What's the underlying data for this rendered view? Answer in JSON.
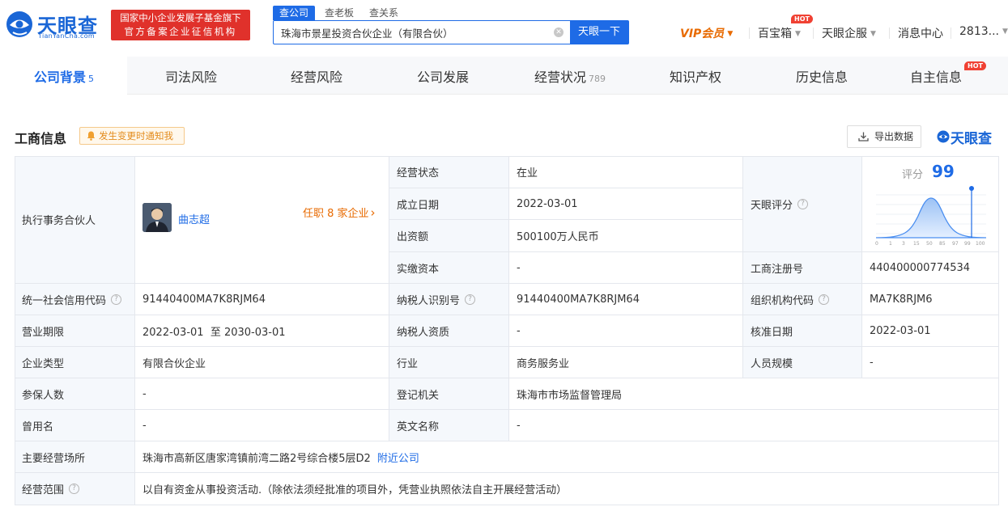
{
  "header": {
    "logo_cn": "天眼查",
    "logo_en": "TianYanCha.com",
    "banner_line1": "国家中小企业发展子基金旗下",
    "banner_line2": "官方备案企业征信机构",
    "search_tabs": [
      "查公司",
      "查老板",
      "查关系"
    ],
    "search_value": "珠海市景星投资合伙企业（有限合伙）",
    "search_button": "天眼一下",
    "nav": {
      "vip": "VIP会员",
      "baibaoxiang": "百宝箱",
      "hot": "HOT",
      "qifu": "天眼企服",
      "messages": "消息中心",
      "account": "2813..."
    }
  },
  "tabs": [
    {
      "label": "公司背景",
      "count": "5"
    },
    {
      "label": "司法风险",
      "count": ""
    },
    {
      "label": "经营风险",
      "count": ""
    },
    {
      "label": "公司发展",
      "count": ""
    },
    {
      "label": "经营状况",
      "count": "789"
    },
    {
      "label": "知识产权",
      "count": ""
    },
    {
      "label": "历史信息",
      "count": ""
    },
    {
      "label": "自主信息",
      "count": ""
    }
  ],
  "tab_hot": "HOT",
  "section": {
    "title": "工商信息",
    "notify": "发生变更时通知我",
    "export": "导出数据",
    "brand": "天眼查"
  },
  "info": {
    "partner_label": "执行事务合伙人",
    "partner_name": "曲志超",
    "partner_tenure": "任职 8 家企业",
    "status_label": "经营状态",
    "status": "在业",
    "founded_label": "成立日期",
    "founded": "2022-03-01",
    "capital_label": "出资额",
    "capital": "500100万人民币",
    "paid_label": "实缴资本",
    "paid": "-",
    "score_label": "天眼评分",
    "score_word": "评分",
    "score": "99",
    "score_ticks": [
      "0",
      "1",
      "3",
      "15",
      "50",
      "85",
      "97",
      "99",
      "100"
    ],
    "regno_label": "工商注册号",
    "regno": "440400000774534",
    "credit_label": "统一社会信用代码",
    "credit": "91440400MA7K8RJM64",
    "taxid_label": "纳税人识别号",
    "taxid": "91440400MA7K8RJM64",
    "orgcode_label": "组织机构代码",
    "orgcode": "MA7K8RJM6",
    "term_label": "营业期限",
    "term": "2022-03-01  至 2030-03-01",
    "taxqual_label": "纳税人资质",
    "taxqual": "-",
    "approve_label": "核准日期",
    "approve": "2022-03-01",
    "type_label": "企业类型",
    "type": "有限合伙企业",
    "industry_label": "行业",
    "industry": "商务服务业",
    "staff_label": "人员规模",
    "staff": "-",
    "insured_label": "参保人数",
    "insured": "-",
    "authority_label": "登记机关",
    "authority": "珠海市市场监督管理局",
    "former_label": "曾用名",
    "former": "-",
    "english_label": "英文名称",
    "english": "-",
    "address_label": "主要经营场所",
    "address": "珠海市高新区唐家湾镇前湾二路2号综合楼5层D2",
    "nearby": "附近公司",
    "scope_label": "经营范围",
    "scope": "以自有资金从事投资活动.（除依法须经批准的项目外，凭营业执照依法自主开展经营活动）"
  },
  "colors": {
    "brand_blue": "#1e6be6",
    "accent_orange": "#e86a00",
    "banner_red": "#e0312b",
    "hot_red": "#f04133"
  }
}
